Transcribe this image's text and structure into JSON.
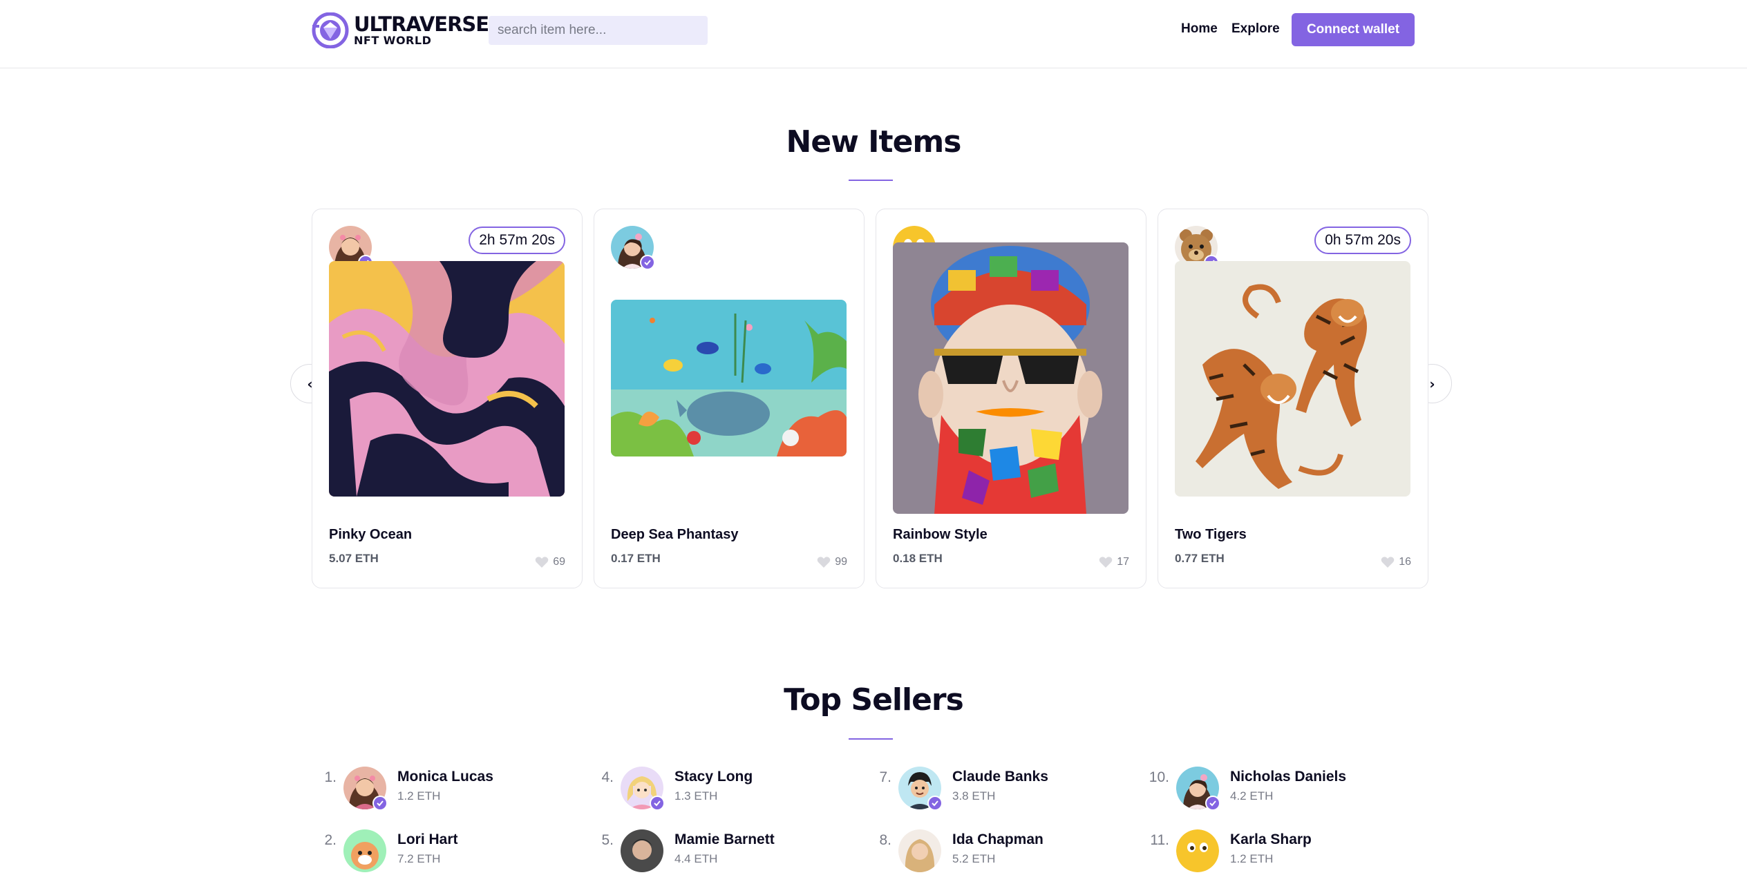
{
  "header": {
    "logo_title": "ULTRAVERSE",
    "logo_subtitle": "NFT WORLD",
    "search_placeholder": "search item here...",
    "nav_home": "Home",
    "nav_explore": "Explore",
    "connect_label": "Connect wallet"
  },
  "colors": {
    "accent": "#8364e2",
    "text": "#0d0c22",
    "muted": "#777a86"
  },
  "new_items": {
    "title": "New Items",
    "prev_icon": "chevron-left-icon",
    "next_icon": "chevron-right-icon",
    "cards": [
      {
        "name": "Pinky Ocean",
        "price": "5.07 ETH",
        "likes": "69",
        "countdown": "2h 57m 20s",
        "image": "pink-marble-art"
      },
      {
        "name": "Deep Sea Phantasy",
        "price": "0.17 ETH",
        "likes": "99",
        "countdown": "",
        "image": "underwater-art"
      },
      {
        "name": "Rainbow Style",
        "price": "0.18 ETH",
        "likes": "17",
        "countdown": "",
        "image": "mosaic-beard-portrait"
      },
      {
        "name": "Two Tigers",
        "price": "0.77 ETH",
        "likes": "16",
        "countdown": "0h 57m 20s",
        "image": "two-tigers-art"
      }
    ]
  },
  "top_sellers": {
    "title": "Top Sellers",
    "sellers": [
      {
        "rank": "1.",
        "name": "Monica Lucas",
        "eth": "1.2 ETH"
      },
      {
        "rank": "2.",
        "name": "Lori Hart",
        "eth": "7.2 ETH"
      },
      {
        "rank": "4.",
        "name": "Stacy Long",
        "eth": "1.3 ETH"
      },
      {
        "rank": "5.",
        "name": "Mamie Barnett",
        "eth": "4.4 ETH"
      },
      {
        "rank": "7.",
        "name": "Claude Banks",
        "eth": "3.8 ETH"
      },
      {
        "rank": "8.",
        "name": "Ida Chapman",
        "eth": "5.2 ETH"
      },
      {
        "rank": "10.",
        "name": "Nicholas Daniels",
        "eth": "4.2 ETH"
      },
      {
        "rank": "11.",
        "name": "Karla Sharp",
        "eth": "1.2 ETH"
      }
    ]
  }
}
